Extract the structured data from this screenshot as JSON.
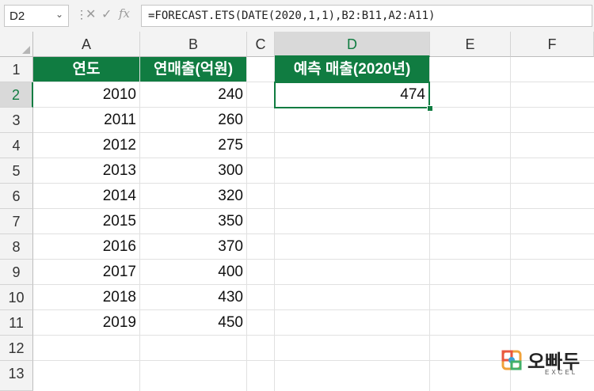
{
  "name_box": {
    "value": "D2"
  },
  "formula_bar": {
    "formula": "=FORECAST.ETS(DATE(2020,1,1),B2:B11,A2:A11)",
    "fx_label": "fx"
  },
  "columns": [
    "A",
    "B",
    "C",
    "D",
    "E",
    "F"
  ],
  "rows": [
    "1",
    "2",
    "3",
    "4",
    "5",
    "6",
    "7",
    "8",
    "9",
    "10",
    "11",
    "12",
    "13"
  ],
  "selected_cell": "D2",
  "table": {
    "header_year": "연도",
    "header_sales": "연매출(억원)",
    "years": [
      "2010",
      "2011",
      "2012",
      "2013",
      "2014",
      "2015",
      "2016",
      "2017",
      "2018",
      "2019"
    ],
    "sales": [
      "240",
      "260",
      "275",
      "300",
      "320",
      "350",
      "370",
      "400",
      "430",
      "450"
    ]
  },
  "forecast": {
    "header": "예측 매출(2020년)",
    "value": "474"
  },
  "colors": {
    "accent": "#107c41",
    "header_bg": "#f3f3f3",
    "grid": "#e1e1e1"
  },
  "logo": {
    "brand": "오빠두",
    "sub": "EXCEL"
  }
}
